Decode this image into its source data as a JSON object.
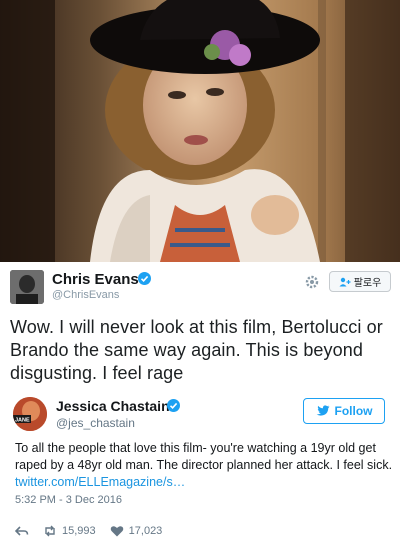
{
  "tweet1": {
    "name": "Chris Evans",
    "handle": "@ChrisEvans",
    "follow_label": "팔로우",
    "text": "Wow. I will never look at this film, Bertolucci or Brando the same way again. This is beyond disgusting. I feel rage"
  },
  "tweet2": {
    "name": "Jessica Chastain",
    "handle": "@jes_chastain",
    "follow_label": "Follow",
    "text": "To all the people that love this film- you're watching a 19yr old get raped by a 48yr old man. The director planned her attack. I feel sick.",
    "link": "twitter.com/ELLEmagazine/s…",
    "timestamp": "5:32 PM - 3 Dec 2016",
    "retweets": "15,993",
    "likes": "17,023",
    "avatar_text": "JANE"
  },
  "colors": {
    "twitter_blue": "#1da1f2",
    "link": "#1b95e0",
    "muted": "#657786"
  }
}
